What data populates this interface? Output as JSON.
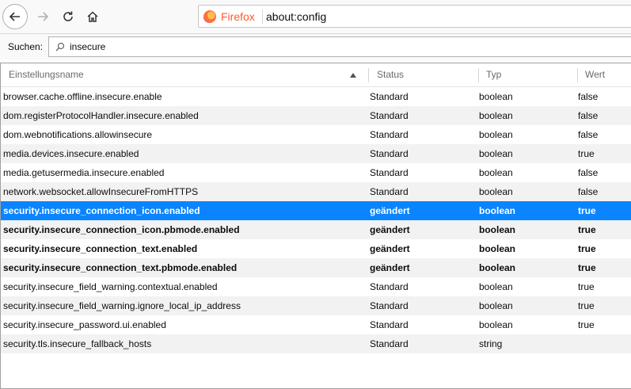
{
  "browser": {
    "identity_label": "Firefox",
    "url": "about:config"
  },
  "search": {
    "label": "Suchen:",
    "value": "insecure"
  },
  "columns": {
    "name": "Einstellungsname",
    "status": "Status",
    "type": "Typ",
    "value": "Wert"
  },
  "rows": [
    {
      "name": "browser.cache.offline.insecure.enable",
      "status": "Standard",
      "type": "boolean",
      "value": "false"
    },
    {
      "name": "dom.registerProtocolHandler.insecure.enabled",
      "status": "Standard",
      "type": "boolean",
      "value": "false"
    },
    {
      "name": "dom.webnotifications.allowinsecure",
      "status": "Standard",
      "type": "boolean",
      "value": "false"
    },
    {
      "name": "media.devices.insecure.enabled",
      "status": "Standard",
      "type": "boolean",
      "value": "true"
    },
    {
      "name": "media.getusermedia.insecure.enabled",
      "status": "Standard",
      "type": "boolean",
      "value": "false"
    },
    {
      "name": "network.websocket.allowInsecureFromHTTPS",
      "status": "Standard",
      "type": "boolean",
      "value": "false"
    },
    {
      "name": "security.insecure_connection_icon.enabled",
      "status": "geändert",
      "type": "boolean",
      "value": "true"
    },
    {
      "name": "security.insecure_connection_icon.pbmode.enabled",
      "status": "geändert",
      "type": "boolean",
      "value": "true"
    },
    {
      "name": "security.insecure_connection_text.enabled",
      "status": "geändert",
      "type": "boolean",
      "value": "true"
    },
    {
      "name": "security.insecure_connection_text.pbmode.enabled",
      "status": "geändert",
      "type": "boolean",
      "value": "true"
    },
    {
      "name": "security.insecure_field_warning.contextual.enabled",
      "status": "Standard",
      "type": "boolean",
      "value": "true"
    },
    {
      "name": "security.insecure_field_warning.ignore_local_ip_address",
      "status": "Standard",
      "type": "boolean",
      "value": "true"
    },
    {
      "name": "security.insecure_password.ui.enabled",
      "status": "Standard",
      "type": "boolean",
      "value": "true"
    },
    {
      "name": "security.tls.insecure_fallback_hosts",
      "status": "Standard",
      "type": "string",
      "value": ""
    }
  ],
  "selected_row": 6,
  "colors": {
    "selection": "#0a84ff",
    "alt_row": "#f2f2f2",
    "firefox_label": "#ff5a29"
  },
  "icons": [
    "back-arrow-icon",
    "forward-arrow-icon",
    "reload-icon",
    "home-icon",
    "firefox-logo-icon",
    "search-icon",
    "sort-ascending-icon"
  ]
}
